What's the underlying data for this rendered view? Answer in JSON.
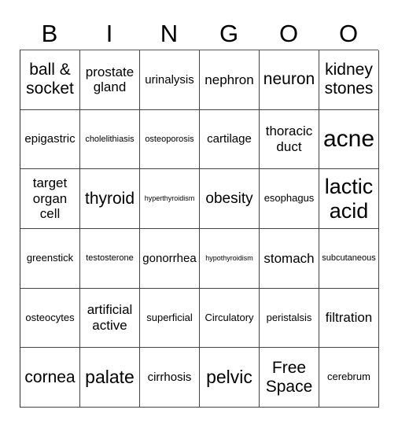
{
  "header": [
    "B",
    "I",
    "N",
    "G",
    "O",
    "O"
  ],
  "cells": [
    {
      "text": "ball & socket",
      "size": "s21"
    },
    {
      "text": "prostate gland",
      "size": "s17"
    },
    {
      "text": "urinalysis",
      "size": "s15"
    },
    {
      "text": "nephron",
      "size": "s17"
    },
    {
      "text": "neuron",
      "size": "s21"
    },
    {
      "text": "kidney stones",
      "size": "s21"
    },
    {
      "text": "epigastric",
      "size": "s15"
    },
    {
      "text": "cholelithiasis",
      "size": "s11"
    },
    {
      "text": "osteoporosis",
      "size": "s11"
    },
    {
      "text": "cartilage",
      "size": "s15"
    },
    {
      "text": "thoracic duct",
      "size": "s17"
    },
    {
      "text": "acne",
      "size": "s30"
    },
    {
      "text": "target organ cell",
      "size": "s17"
    },
    {
      "text": "thyroid",
      "size": "s21"
    },
    {
      "text": "hyperthyroidism",
      "size": "s9"
    },
    {
      "text": "obesity",
      "size": "s19"
    },
    {
      "text": "esophagus",
      "size": "s13"
    },
    {
      "text": "lactic acid",
      "size": "s26"
    },
    {
      "text": "greenstick",
      "size": "s13"
    },
    {
      "text": "testosterone",
      "size": "s11"
    },
    {
      "text": "gonorrhea",
      "size": "s15"
    },
    {
      "text": "hypothyroidism",
      "size": "s9"
    },
    {
      "text": "stomach",
      "size": "s17"
    },
    {
      "text": "subcutaneous",
      "size": "s11"
    },
    {
      "text": "osteocytes",
      "size": "s13"
    },
    {
      "text": "artificial active",
      "size": "s17"
    },
    {
      "text": "superficial",
      "size": "s13"
    },
    {
      "text": "Circulatory",
      "size": "s13"
    },
    {
      "text": "peristalsis",
      "size": "s13"
    },
    {
      "text": "filtration",
      "size": "s17"
    },
    {
      "text": "cornea",
      "size": "s21"
    },
    {
      "text": "palate",
      "size": "s23"
    },
    {
      "text": "cirrhosis",
      "size": "s15"
    },
    {
      "text": "pelvic",
      "size": "s23"
    },
    {
      "text": "Free Space",
      "size": "s21"
    },
    {
      "text": "cerebrum",
      "size": "s13"
    }
  ]
}
